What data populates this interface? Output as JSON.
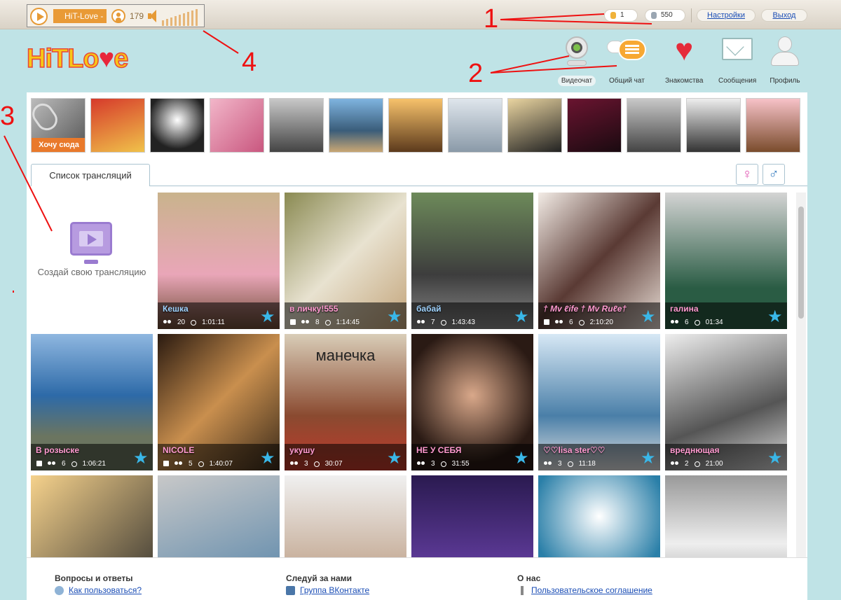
{
  "player": {
    "station": "HiT-Love -",
    "listeners": "179"
  },
  "topbar": {
    "likes": "1",
    "coins": "550",
    "settings": "Настройки",
    "logout": "Выход"
  },
  "logo": {
    "text_a": "HiTLo",
    "text_b": "e"
  },
  "nav": [
    {
      "label": "Видеочат",
      "icon": "webcam-icon"
    },
    {
      "label": "Общий чат",
      "icon": "chat-bubbles-icon"
    },
    {
      "label": "Знакомства",
      "icon": "hearts-icon"
    },
    {
      "label": "Сообщения",
      "icon": "envelope-icon"
    },
    {
      "label": "Профиль",
      "icon": "user-icon"
    }
  ],
  "strip": {
    "want_here": "Хочу сюда"
  },
  "tabs": {
    "broadcast_list": "Список трансляций",
    "female": "♀",
    "male": "♂"
  },
  "create": {
    "label": "Создай свою трансляцию"
  },
  "streams": [
    {
      "name": "Кешка",
      "viewers": "20",
      "time": "1:01:11",
      "locked": false
    },
    {
      "name": "в личку!555",
      "viewers": "8",
      "time": "1:14:45",
      "locked": true
    },
    {
      "name": "бабай",
      "viewers": "7",
      "time": "1:43:43",
      "locked": false
    },
    {
      "name": "† Mv ℓife † Mv Ruℓe†",
      "viewers": "6",
      "time": "2:10:20",
      "locked": true
    },
    {
      "name": "галина",
      "viewers": "6",
      "time": "01:34",
      "locked": false
    },
    {
      "name": "В розыске",
      "viewers": "6",
      "time": "1:06:21",
      "locked": true
    },
    {
      "name": "NICOLE",
      "viewers": "5",
      "time": "1:40:07",
      "locked": true
    },
    {
      "name": "укушу",
      "viewers": "3",
      "time": "30:07",
      "locked": false
    },
    {
      "name": "НЕ У СЕБЯ",
      "viewers": "3",
      "time": "31:55",
      "locked": false
    },
    {
      "name": "♡♡lisa ster♡♡",
      "viewers": "3",
      "time": "11:18",
      "locked": false
    },
    {
      "name": "вреднющая",
      "viewers": "2",
      "time": "21:00",
      "locked": false
    }
  ],
  "photo_caption": "манечка",
  "footer": {
    "faq": "Вопросы и ответы",
    "faq_link": "Как пользоваться?",
    "follow": "Следуй за нами",
    "follow_link": "Группа ВКонтакте",
    "about": "О нас",
    "about_link": "Пользовательское соглашение"
  },
  "annotations": [
    "1",
    "2",
    "3",
    "4"
  ],
  "colors": {
    "accent": "#e9792b",
    "link": "#1a4db5",
    "annotation": "#e11111"
  }
}
